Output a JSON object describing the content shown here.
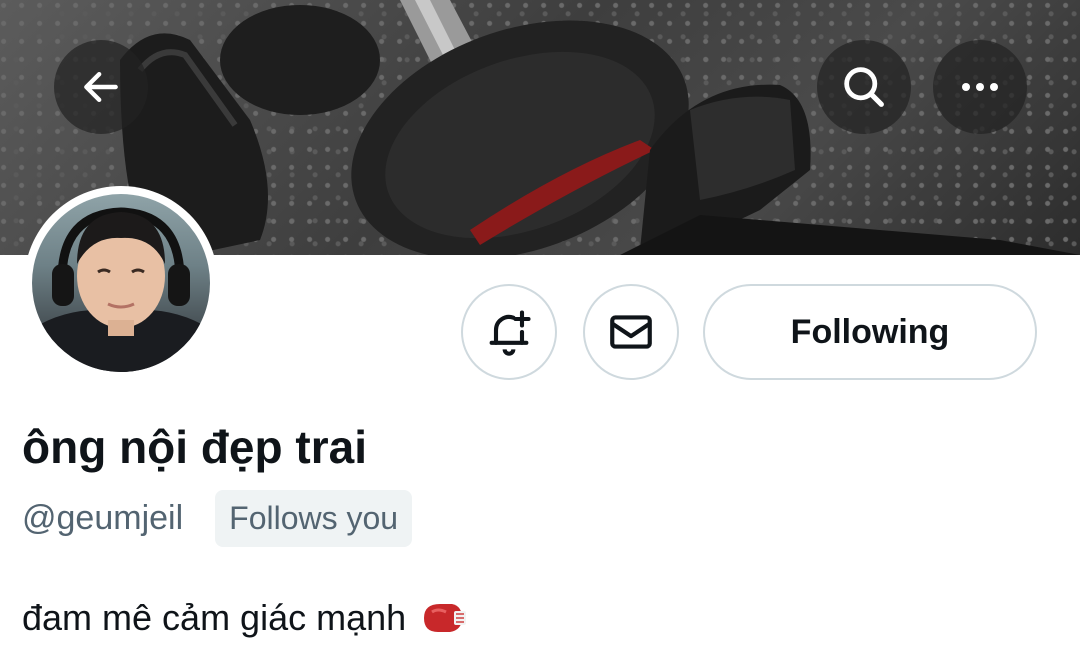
{
  "header": {
    "back_icon": "arrow-left-icon",
    "search_icon": "search-icon",
    "more_icon": "more-horizontal-icon"
  },
  "profile": {
    "display_name": "ông nội đẹp trai",
    "handle": "@geumjeil",
    "follows_you_label": "Follows you",
    "bio_text": "đam mê cảm giác mạnh",
    "bio_emoji": "boxing-glove-icon"
  },
  "actions": {
    "notify_icon": "bell-plus-icon",
    "message_icon": "envelope-icon",
    "following_label": "Following"
  },
  "colors": {
    "text_primary": "#0f1419",
    "text_secondary": "#536471",
    "border": "#cfd9de",
    "badge_bg": "#eff3f4"
  }
}
